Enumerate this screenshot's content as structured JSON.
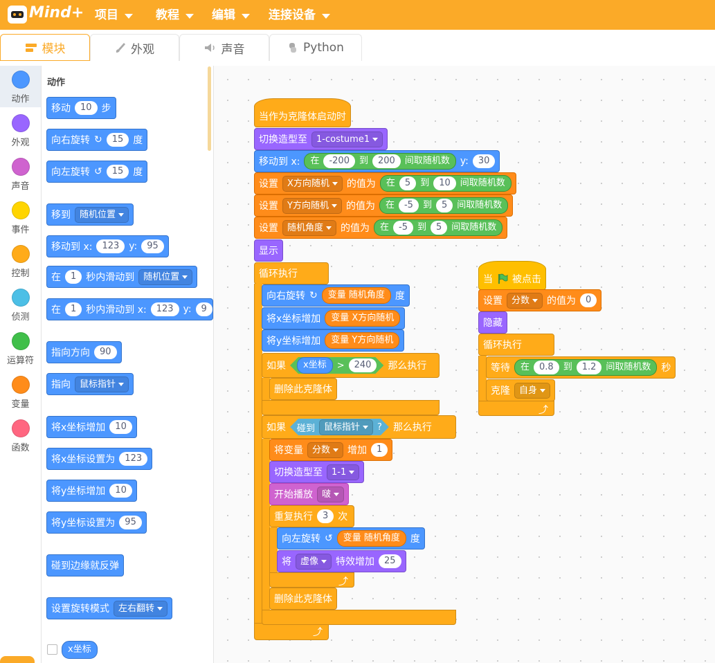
{
  "header": {
    "logo": "Mind+",
    "menus": [
      "项目",
      "教程",
      "编辑",
      "连接设备"
    ]
  },
  "tabs": [
    {
      "label": "模块"
    },
    {
      "label": "外观"
    },
    {
      "label": "声音"
    },
    {
      "label": "Python"
    }
  ],
  "categories": [
    {
      "label": "动作",
      "color": "#4c97ff"
    },
    {
      "label": "外观",
      "color": "#9966ff"
    },
    {
      "label": "声音",
      "color": "#cf63cf"
    },
    {
      "label": "事件",
      "color": "#ffd500"
    },
    {
      "label": "控制",
      "color": "#ffab19"
    },
    {
      "label": "侦测",
      "color": "#4cbfe6"
    },
    {
      "label": "运算符",
      "color": "#40bf4a"
    },
    {
      "label": "变量",
      "color": "#ff8c1a"
    },
    {
      "label": "函数",
      "color": "#ff6680"
    }
  ],
  "palette": {
    "section": "动作",
    "move": {
      "t": "移动",
      "n": "10",
      "u": "步"
    },
    "turn_right": {
      "t": "向右旋转",
      "n": "15",
      "u": "度"
    },
    "turn_left": {
      "t": "向左旋转",
      "n": "15",
      "u": "度"
    },
    "goto": {
      "t": "移到",
      "d": "随机位置"
    },
    "goto_xy": {
      "t": "移动到 x:",
      "x": "123",
      "yl": "y:",
      "y": "95"
    },
    "glide": {
      "t1": "在",
      "n": "1",
      "t2": "秒内滑动到",
      "d": "随机位置"
    },
    "glide_xy": {
      "t1": "在",
      "n": "1",
      "t2": "秒内滑动到 x:",
      "x": "123",
      "yl": "y:",
      "y": "9"
    },
    "point_dir": {
      "t": "指向方向",
      "n": "90"
    },
    "point_to": {
      "t": "指向",
      "d": "鼠标指针"
    },
    "change_x": {
      "t": "将x坐标增加",
      "n": "10"
    },
    "set_x": {
      "t": "将x坐标设置为",
      "n": "123"
    },
    "change_y": {
      "t": "将y坐标增加",
      "n": "10"
    },
    "set_y": {
      "t": "将y坐标设置为",
      "n": "95"
    },
    "bounce": {
      "t": "碰到边缘就反弹"
    },
    "rot_style": {
      "t": "设置旋转模式",
      "d": "左右翻转"
    },
    "xpos": {
      "t": "x坐标"
    }
  },
  "script1": {
    "hat": "当作为克隆体启动时",
    "costume": {
      "t": "切换造型至",
      "d": "1-costume1"
    },
    "goto": {
      "t": "移动到 x:",
      "r1": "在",
      "a": "-200",
      "r2": "到",
      "b": "200",
      "r3": "间取随机数",
      "yl": "y:",
      "y": "30"
    },
    "setx": {
      "t": "设置",
      "d": "X方向随机",
      "m": "的值为",
      "r1": "在",
      "a": "5",
      "r2": "到",
      "b": "10",
      "r3": "间取随机数"
    },
    "sety": {
      "t": "设置",
      "d": "Y方向随机",
      "m": "的值为",
      "r1": "在",
      "a": "-5",
      "r2": "到",
      "b": "5",
      "r3": "间取随机数"
    },
    "setang": {
      "t": "设置",
      "d": "随机角度",
      "m": "的值为",
      "r1": "在",
      "a": "-5",
      "r2": "到",
      "b": "5",
      "r3": "间取随机数"
    },
    "show": "显示",
    "forever": "循环执行",
    "turn_right": {
      "t": "向右旋转",
      "v": "变量 随机角度",
      "u": "度"
    },
    "changex": {
      "t": "将x坐标增加",
      "v": "变量 X方向随机"
    },
    "changey": {
      "t": "将y坐标增加",
      "v": "变量 Y方向随机"
    },
    "if1": {
      "t": "如果",
      "r": "x坐标",
      "op": ">",
      "n": "240",
      "then": "那么执行"
    },
    "delete1": "删除此克隆体",
    "if2": {
      "t": "如果",
      "r1": "碰到",
      "d": "鼠标指针",
      "q": "?",
      "then": "那么执行"
    },
    "changescore": {
      "t": "将变量",
      "d": "分数",
      "m": "增加",
      "n": "1"
    },
    "costume2": {
      "t": "切换造型至",
      "d": "1-1"
    },
    "sound": {
      "t": "开始播放",
      "d": "啵"
    },
    "repeat": {
      "t": "重复执行",
      "n": "3",
      "u": "次"
    },
    "turn_left": {
      "t": "向左旋转",
      "v": "变量 随机角度",
      "u": "度"
    },
    "effect": {
      "t": "将",
      "d": "虚像",
      "m": "特效增加",
      "n": "25"
    },
    "delete2": "删除此克隆体"
  },
  "script2": {
    "hat": {
      "t1": "当",
      "t2": "被点击"
    },
    "setscore": {
      "t": "设置",
      "d": "分数",
      "m": "的值为",
      "n": "0"
    },
    "hide": "隐藏",
    "forever": "循环执行",
    "wait": {
      "t": "等待",
      "r1": "在",
      "a": "0.8",
      "r2": "到",
      "b": "1.2",
      "r3": "间取随机数",
      "u": "秒"
    },
    "clone": {
      "t": "克隆",
      "d": "自身"
    }
  }
}
